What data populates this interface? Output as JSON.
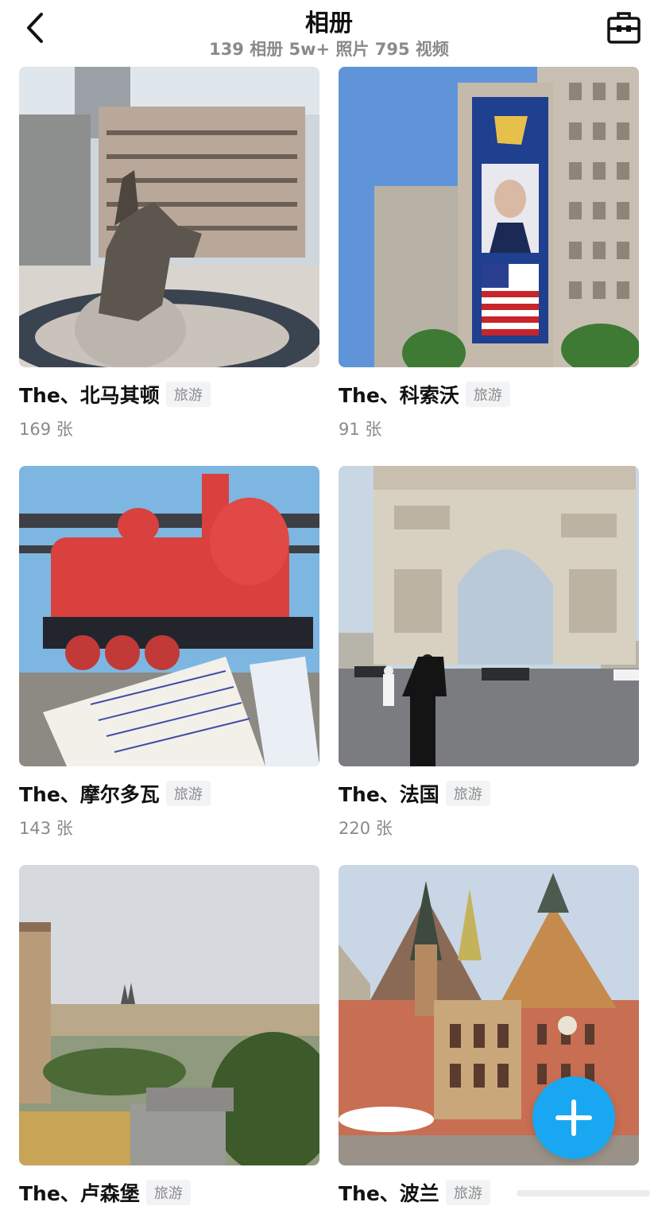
{
  "header": {
    "title": "相册",
    "subtitle": "139 相册 5w+ 照片 795 视频",
    "back_icon": "chevron-left-icon",
    "toolbox_icon": "toolbox-icon"
  },
  "albums": [
    {
      "name": "The、北马其顿",
      "tag": "旅游",
      "count": "169 张"
    },
    {
      "name": "The、科索沃",
      "tag": "旅游",
      "count": "91 张"
    },
    {
      "name": "The、摩尔多瓦",
      "tag": "旅游",
      "count": "143 张"
    },
    {
      "name": "The、法国",
      "tag": "旅游",
      "count": "220 张"
    },
    {
      "name": "The、卢森堡",
      "tag": "旅游",
      "count": ""
    },
    {
      "name": "The、波兰",
      "tag": "旅游",
      "count": ""
    }
  ],
  "fab": {
    "icon": "plus-icon"
  },
  "colors": {
    "accent": "#1aa7f2",
    "tag_bg": "#f2f3f5",
    "muted": "#8a8a8a"
  }
}
